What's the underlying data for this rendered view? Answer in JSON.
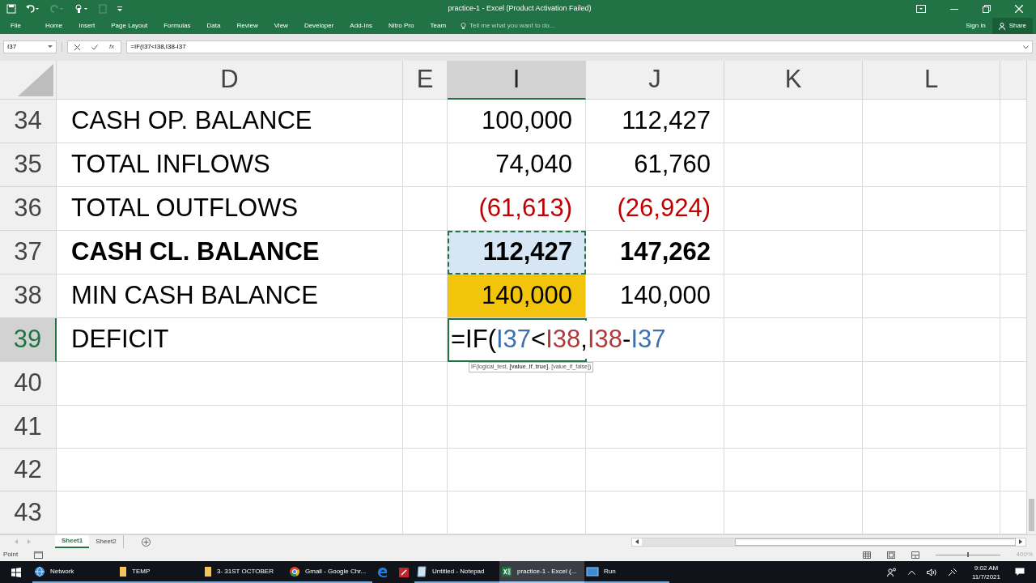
{
  "title_bar": {
    "title": "practice-1 - Excel (Product Activation Failed)"
  },
  "ribbon_tabs": [
    "File",
    "Home",
    "Insert",
    "Page Layout",
    "Formulas",
    "Data",
    "Review",
    "View",
    "Developer",
    "Add-Ins",
    "Nitro Pro",
    "Team"
  ],
  "tell_me": {
    "placeholder": "Tell me what you want to do..."
  },
  "account": {
    "sign_in": "Sign in",
    "share": "Share"
  },
  "formula_bar": {
    "name_box": "I37",
    "function_label": "fx",
    "formula": "=IF(I37<I38,I38-I37"
  },
  "columns": [
    {
      "label": "D",
      "selected": false
    },
    {
      "label": "E",
      "selected": false
    },
    {
      "label": "I",
      "selected": true
    },
    {
      "label": "J",
      "selected": false
    },
    {
      "label": "K",
      "selected": false
    },
    {
      "label": "L",
      "selected": false
    }
  ],
  "rows": [
    {
      "number": "34",
      "selected": false,
      "col_d": {
        "text": "CASH OP. BALANCE",
        "bold": false
      },
      "col_i": {
        "text": "100,000",
        "bold": false
      },
      "col_j": {
        "text": "112,427",
        "bold": false
      }
    },
    {
      "number": "35",
      "selected": false,
      "col_d": {
        "text": "TOTAL INFLOWS",
        "bold": false
      },
      "col_i": {
        "text": "74,040",
        "bold": false
      },
      "col_j": {
        "text": "61,760",
        "bold": false
      }
    },
    {
      "number": "36",
      "selected": false,
      "col_d": {
        "text": "TOTAL OUTFLOWS",
        "bold": false
      },
      "col_i": {
        "text": "(61,613)",
        "bold": false,
        "color": "#c00000"
      },
      "col_j": {
        "text": "(26,924)",
        "bold": false,
        "color": "#c00000"
      }
    },
    {
      "number": "37",
      "selected": false,
      "col_d": {
        "text": "CASH CL. BALANCE",
        "bold": true
      },
      "col_i": {
        "text": "112,427",
        "bold": true,
        "selected": true,
        "marquee": true
      },
      "col_j": {
        "text": "147,262",
        "bold": true
      }
    },
    {
      "number": "38",
      "selected": false,
      "col_d": {
        "text": "MIN CASH BALANCE",
        "bold": false
      },
      "col_i": {
        "text": "140,000",
        "bold": false,
        "selected": false,
        "highlighted": true,
        "marquee": false
      },
      "col_j": {
        "text": "140,000",
        "bold": false
      }
    },
    {
      "number": "39",
      "selected": true,
      "col_d": {
        "text": "DEFICIT",
        "bold": false
      },
      "col_i": {
        "kind": "editing",
        "parts": [
          {
            "text": "=IF(",
            "color": "#000000"
          },
          {
            "text": "I37",
            "color": "#3a6fb0"
          },
          {
            "text": "<",
            "color": "#000000"
          },
          {
            "text": "I38",
            "color": "#b03a3a"
          },
          {
            "text": ",",
            "color": "#000000"
          },
          {
            "text": "I38",
            "color": "#b03a3a"
          },
          {
            "text": "-",
            "color": "#000000"
          },
          {
            "text": "I37",
            "color": "#3a6fb0"
          }
        ],
        "tooltip": "IF(logical_test, **[value_if_true]**, [value_if_false])"
      }
    },
    {
      "number": "40",
      "selected": false
    },
    {
      "number": "41",
      "selected": false
    },
    {
      "number": "42",
      "selected": false
    },
    {
      "number": "43",
      "selected": false
    }
  ],
  "sheet_tabs": [
    {
      "label": "Sheet1",
      "selected": true
    },
    {
      "label": "Sheet2",
      "selected": false
    }
  ],
  "status_bar": {
    "mode": "Point",
    "zoom": "400%",
    "zoom_slider": {
      "level": 0.5
    }
  },
  "taskbar": {
    "items": [
      {
        "kind": "globe",
        "label": "Network",
        "active": false
      },
      {
        "kind": "folder",
        "label": "TEMP",
        "active": false
      },
      {
        "kind": "folder",
        "label": "3- 31ST OCTOBER",
        "active": false
      },
      {
        "kind": "chrome",
        "label": "Gmail - Google Chr...",
        "active": false
      },
      {
        "kind": "edge",
        "active": false
      },
      {
        "kind": "redapp",
        "active": false
      },
      {
        "kind": "notepad",
        "label": "Untitled - Notepad",
        "active": false
      },
      {
        "kind": "excel",
        "label": "practice-1 - Excel (...",
        "active": true
      },
      {
        "kind": "run",
        "label": "Run",
        "active": false
      }
    ],
    "time": "9:02 AM",
    "date": "11/7/2021"
  }
}
